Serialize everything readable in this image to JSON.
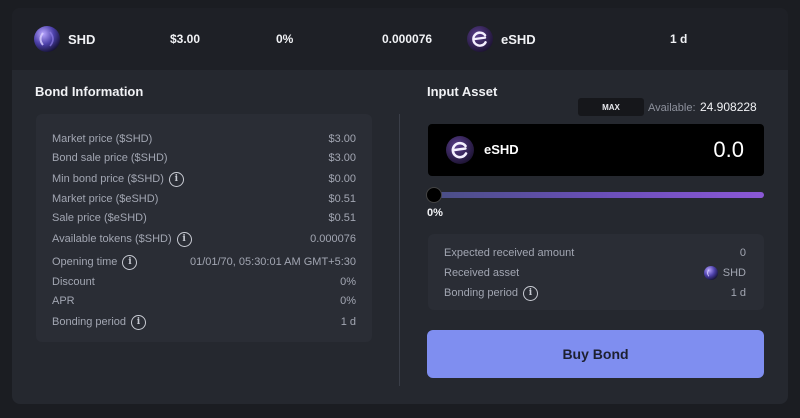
{
  "topbar": {
    "token_name": "SHD",
    "price": "$3.00",
    "discount": "0%",
    "tokens": "0.000076",
    "bond_asset": "eSHD",
    "period": "1 d"
  },
  "bond_info": {
    "title": "Bond Information",
    "rows": [
      {
        "label": "Market price ($SHD)",
        "value": "$3.00",
        "info": false
      },
      {
        "label": "Bond sale price ($SHD)",
        "value": "$3.00",
        "info": false
      },
      {
        "label": "Min bond price ($SHD)",
        "value": "$0.00",
        "info": true
      },
      {
        "label": "Market price ($eSHD)",
        "value": "$0.51",
        "info": false
      },
      {
        "label": "Sale price ($eSHD)",
        "value": "$0.51",
        "info": false
      },
      {
        "label": "Available tokens ($SHD)",
        "value": "0.000076",
        "info": true
      },
      {
        "label": "Opening time",
        "value": "01/01/70, 05:30:01 AM GMT+5:30",
        "info": true
      },
      {
        "label": "Discount",
        "value": "0%",
        "info": false
      },
      {
        "label": "APR",
        "value": "0%",
        "info": false
      },
      {
        "label": "Bonding period",
        "value": "1 d",
        "info": true
      }
    ]
  },
  "input_asset": {
    "title": "Input Asset",
    "max_label": "MAX",
    "available_label": "Available:",
    "available_value": "24.908228",
    "asset_name": "eSHD",
    "amount": "0.0",
    "slider_percent": "0%",
    "slider_value": 0
  },
  "receive": {
    "rows": [
      {
        "label": "Expected received amount",
        "value": "0"
      },
      {
        "label": "Received asset",
        "value": "SHD"
      },
      {
        "label": "Bonding period",
        "value": "1 d"
      }
    ]
  },
  "buy_button_label": "Buy Bond",
  "info_glyph": "i",
  "colors": {
    "panel": "#25282f",
    "card": "#2a2d35",
    "accent_button": "#7f8ef0",
    "slider_start": "#4a4f86",
    "slider_end": "#8b58d6"
  }
}
